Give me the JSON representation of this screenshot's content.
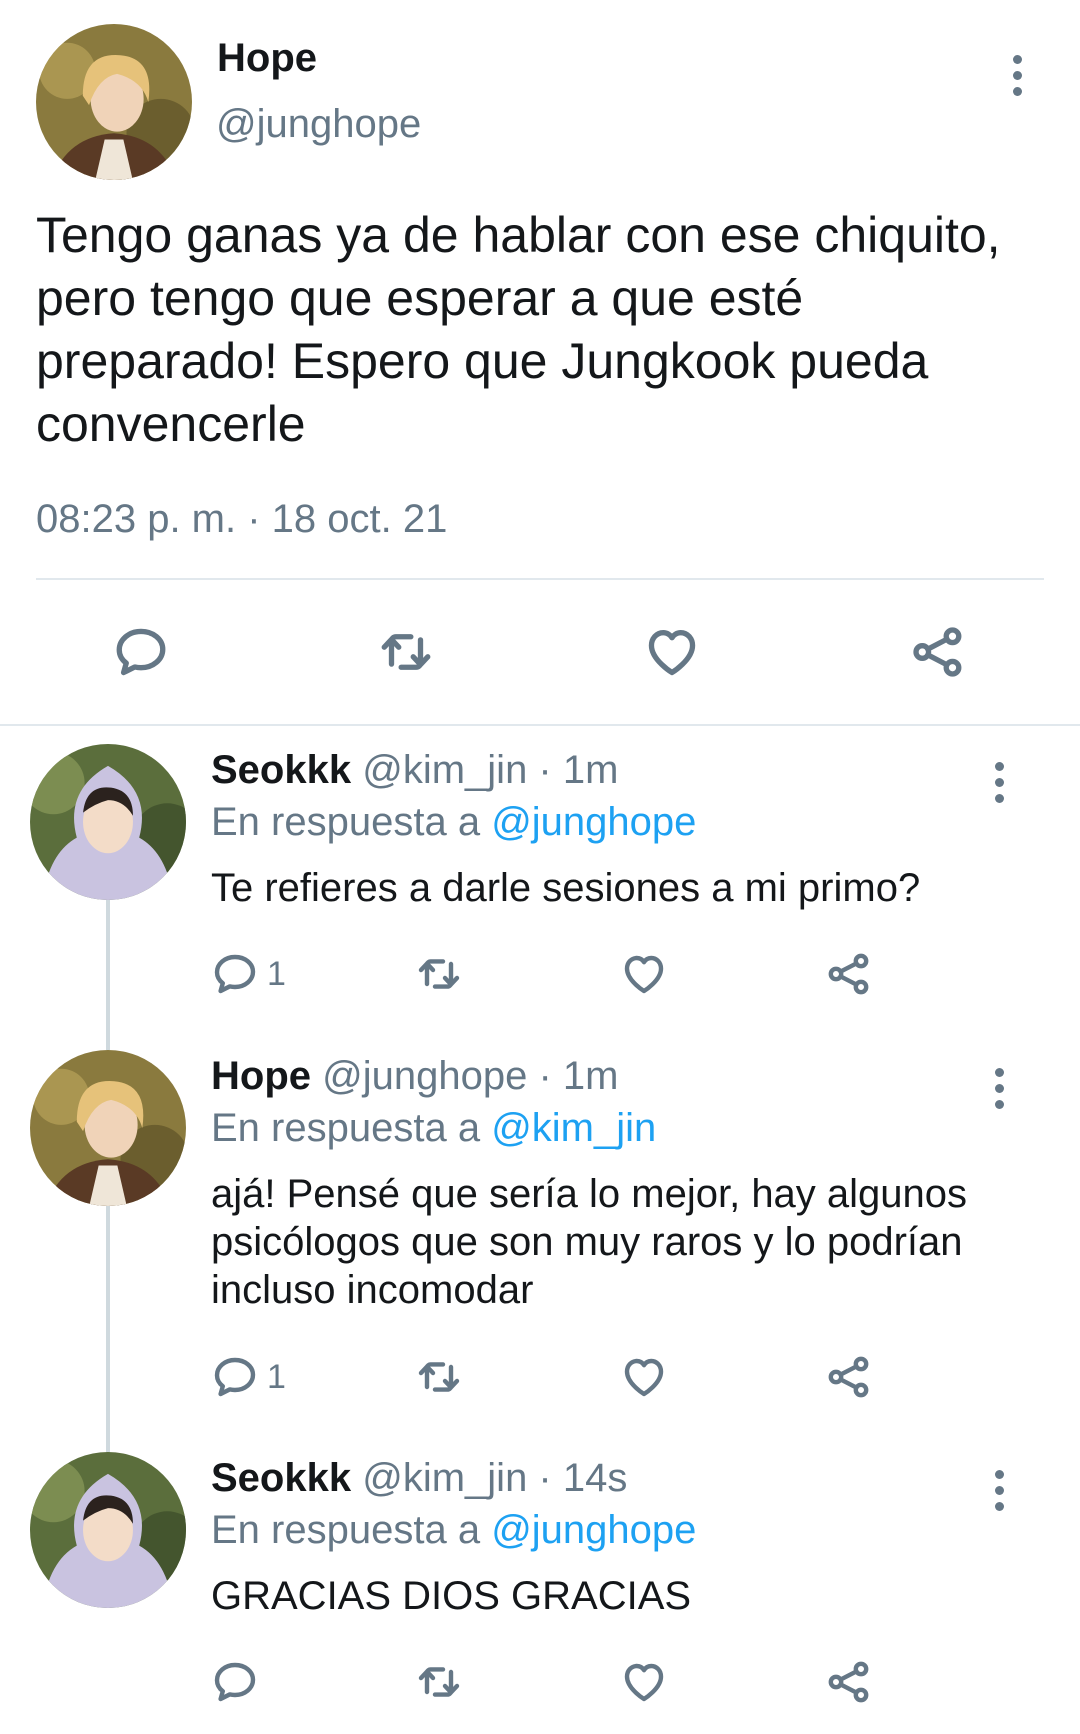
{
  "main_tweet": {
    "name": "Hope",
    "handle": "@junghope",
    "text": "Tengo ganas ya de hablar con ese chiquito, pero tengo que esperar a que esté preparado! Espero que Jungkook pueda convencerle",
    "timestamp": "08:23 p. m. · 18 oct. 21",
    "actions": [
      "reply-icon",
      "retweet-icon",
      "like-icon",
      "share-icon"
    ]
  },
  "replies": [
    {
      "name": "Seokkk",
      "handle": "@kim_jin",
      "separator": " · ",
      "time": "1m",
      "reply_prefix": "En respuesta a ",
      "reply_to": "@junghope",
      "text": "Te refieres a darle sesiones a mi primo?",
      "reply_count": "1"
    },
    {
      "name": "Hope",
      "handle": "@junghope",
      "separator": " · ",
      "time": "1m",
      "reply_prefix": "En respuesta a ",
      "reply_to": "@kim_jin",
      "text": "ajá! Pensé que sería lo mejor, hay algunos psicólogos que son muy raros y lo podrían incluso incomodar",
      "reply_count": "1"
    },
    {
      "name": "Seokkk",
      "handle": "@kim_jin",
      "separator": " · ",
      "time": "14s",
      "reply_prefix": "En respuesta a ",
      "reply_to": "@junghope",
      "text": "GRACIAS DIOS GRACIAS",
      "reply_count": ""
    }
  ],
  "colors": {
    "text": "#14171a",
    "secondary": "#657786",
    "link": "#1da1f2",
    "divider": "#e1e8ed"
  }
}
